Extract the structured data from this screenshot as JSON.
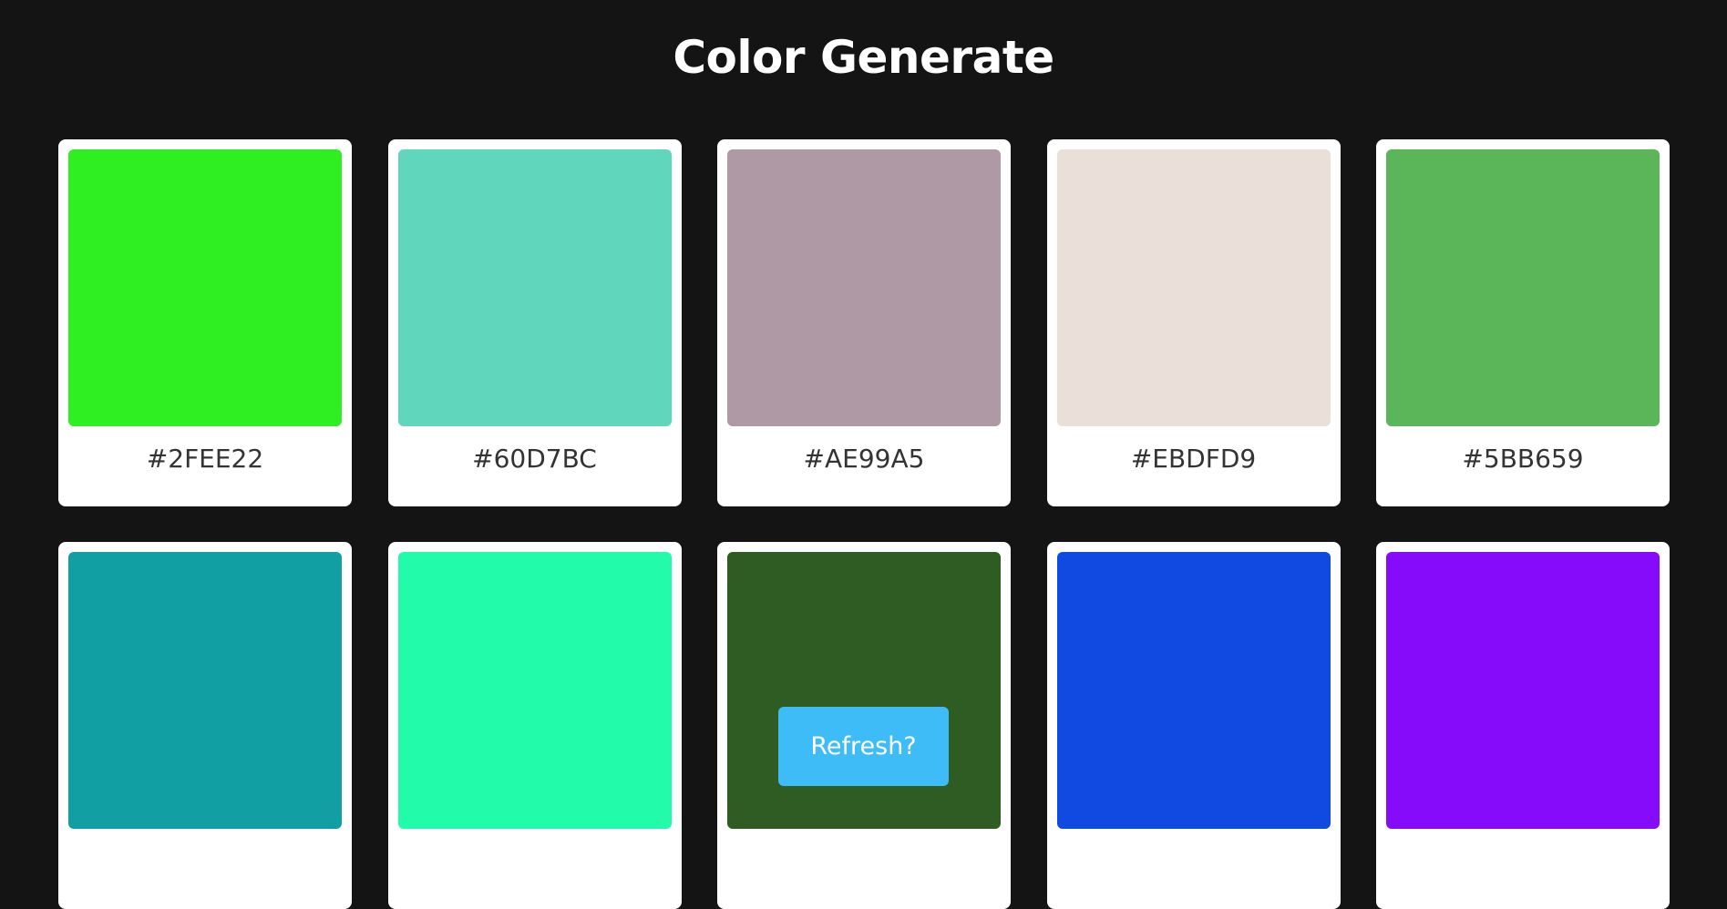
{
  "header": {
    "title": "Color Generate"
  },
  "palette": [
    {
      "hex": "#2FEE22",
      "color": "#2FEE22"
    },
    {
      "hex": "#60D7BC",
      "color": "#60D7BC"
    },
    {
      "hex": "#AE99A5",
      "color": "#AE99A5"
    },
    {
      "hex": "#EBDFD9",
      "color": "#EBDFD9"
    },
    {
      "hex": "#5BB659",
      "color": "#5BB659"
    },
    {
      "hex": "",
      "color": "#129FA3"
    },
    {
      "hex": "",
      "color": "#22FBAA"
    },
    {
      "hex": "",
      "color": "#2F5C22"
    },
    {
      "hex": "",
      "color": "#114AE0"
    },
    {
      "hex": "",
      "color": "#870BFB"
    }
  ],
  "actions": {
    "refresh_label": "Refresh?"
  },
  "theme": {
    "background": "#141414",
    "card_background": "#FFFFFF",
    "button_color": "#3EBCF8"
  }
}
